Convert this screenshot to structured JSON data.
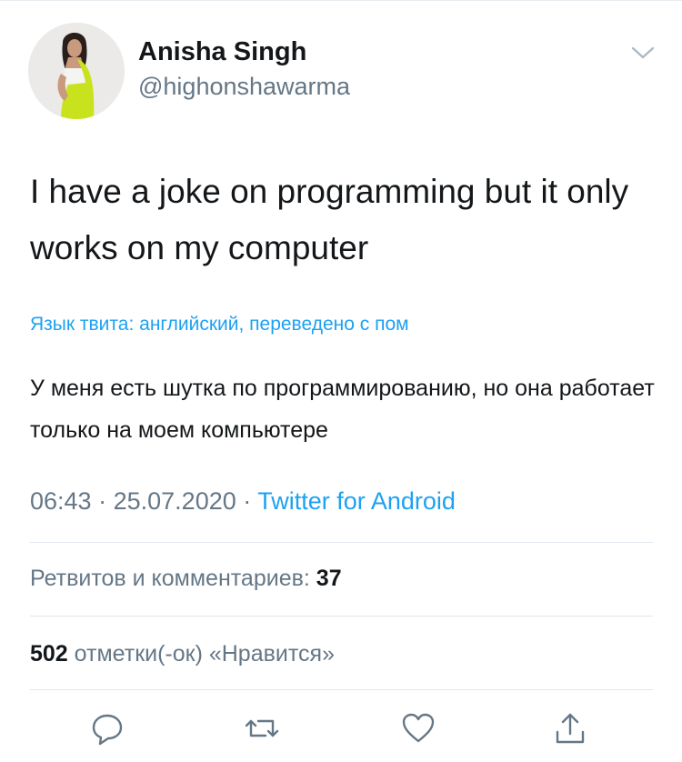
{
  "author": {
    "name": "Anisha Singh",
    "handle": "@highonshawarma"
  },
  "tweet": {
    "text": "I have a joke on programming but it only works on my computer",
    "translation_note": "Язык твита: английский, переведено с пом",
    "translation": "У меня есть шутка по программированию, но она работает только на моем компьютере"
  },
  "meta": {
    "time": "06:43",
    "separator": "·",
    "date": "25.07.2020",
    "source": "Twitter for Android"
  },
  "stats": {
    "retweets_label": "Ретвитов и комментариев:",
    "retweets_count": "37",
    "likes_count": "502",
    "likes_label": "отметки(-ок) «Нравится»"
  },
  "actions": [
    {
      "icon": "reply-icon"
    },
    {
      "icon": "retweet-icon"
    },
    {
      "icon": "like-icon"
    },
    {
      "icon": "share-icon"
    }
  ],
  "colors": {
    "link": "#1da1f2",
    "secondary_text": "#657786",
    "primary_text": "#14171a",
    "divider": "#e1e8ed"
  }
}
